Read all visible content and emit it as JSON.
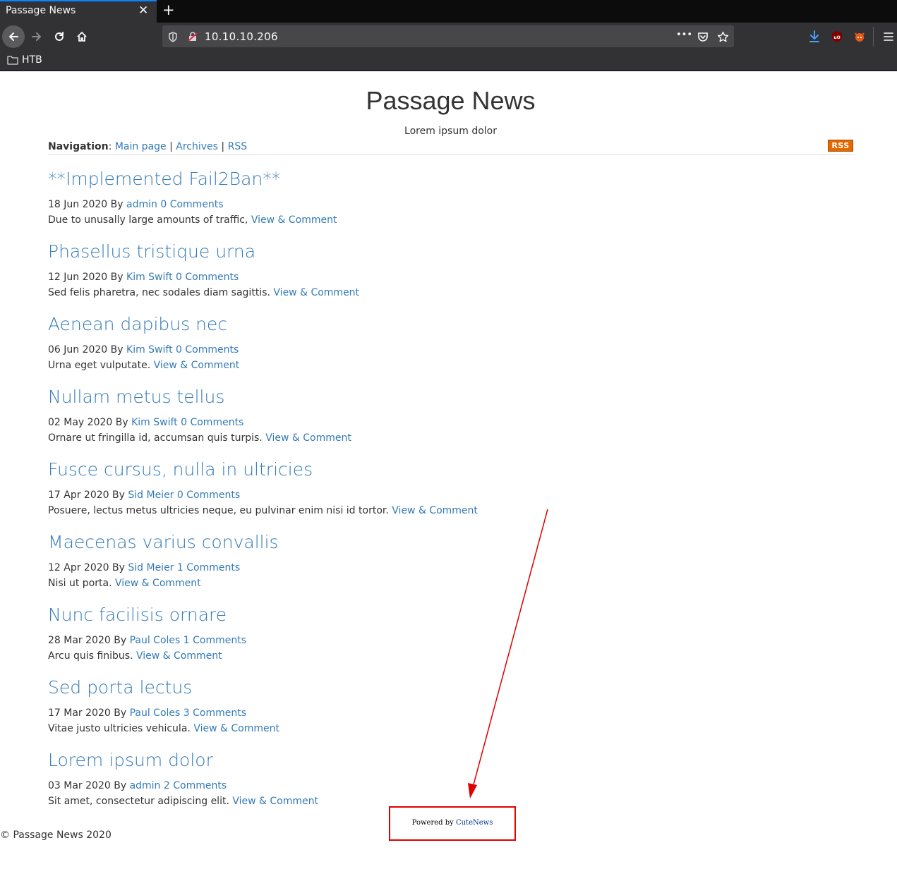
{
  "browser": {
    "tab_title": "Passage News",
    "tab_close": "✕",
    "new_tab": "+",
    "url": "10.10.10.206",
    "url_more": "•••",
    "bookmark_folder": "HTB"
  },
  "site": {
    "title": "Passage News",
    "tagline": "Lorem ipsum dolor",
    "nav_label": "Navigation",
    "nav_sep_colon": ":",
    "nav_links": [
      "Main page",
      "Archives",
      "RSS"
    ],
    "nav_sep": "|",
    "rss_badge": "RSS",
    "by": "By",
    "view_comment": "View & Comment",
    "footer": "© Passage News 2020",
    "powered_by": "Powered by",
    "powered_link": "CuteNews"
  },
  "posts": [
    {
      "title": "**Implemented Fail2Ban**",
      "date": "18 Jun 2020",
      "author": "admin",
      "comments": "0 Comments",
      "excerpt": "Due to unusally large amounts of traffic,"
    },
    {
      "title": "Phasellus tristique urna",
      "date": "12 Jun 2020",
      "author": "Kim Swift",
      "comments": "0 Comments",
      "excerpt": "Sed felis pharetra, nec sodales diam sagittis."
    },
    {
      "title": "Aenean dapibus nec",
      "date": "06 Jun 2020",
      "author": "Kim Swift",
      "comments": "0 Comments",
      "excerpt": "Urna eget vulputate."
    },
    {
      "title": "Nullam metus tellus",
      "date": "02 May 2020",
      "author": "Kim Swift",
      "comments": "0 Comments",
      "excerpt": "Ornare ut fringilla id, accumsan quis turpis."
    },
    {
      "title": "Fusce cursus, nulla in ultricies",
      "date": "17 Apr 2020",
      "author": "Sid Meier",
      "comments": "0 Comments",
      "excerpt": "Posuere, lectus metus ultricies neque, eu pulvinar enim nisi id tortor."
    },
    {
      "title": "Maecenas varius convallis",
      "date": "12 Apr 2020",
      "author": "Sid Meier",
      "comments": "1 Comments",
      "excerpt": "Nisi ut porta."
    },
    {
      "title": "Nunc facilisis ornare",
      "date": "28 Mar 2020",
      "author": "Paul Coles",
      "comments": "1 Comments",
      "excerpt": "Arcu quis finibus."
    },
    {
      "title": "Sed porta lectus",
      "date": "17 Mar 2020",
      "author": "Paul Coles",
      "comments": "3 Comments",
      "excerpt": "Vitae justo ultricies vehicula."
    },
    {
      "title": "Lorem ipsum dolor",
      "date": "03 Mar 2020",
      "author": "admin",
      "comments": "2 Comments",
      "excerpt": "Sit amet, consectetur adipiscing elit."
    }
  ],
  "colors": {
    "link": "#337ab7",
    "annotation": "#e00000",
    "rss": "#e26a00",
    "chrome_dark": "#0c0c0d",
    "chrome": "#323234"
  }
}
